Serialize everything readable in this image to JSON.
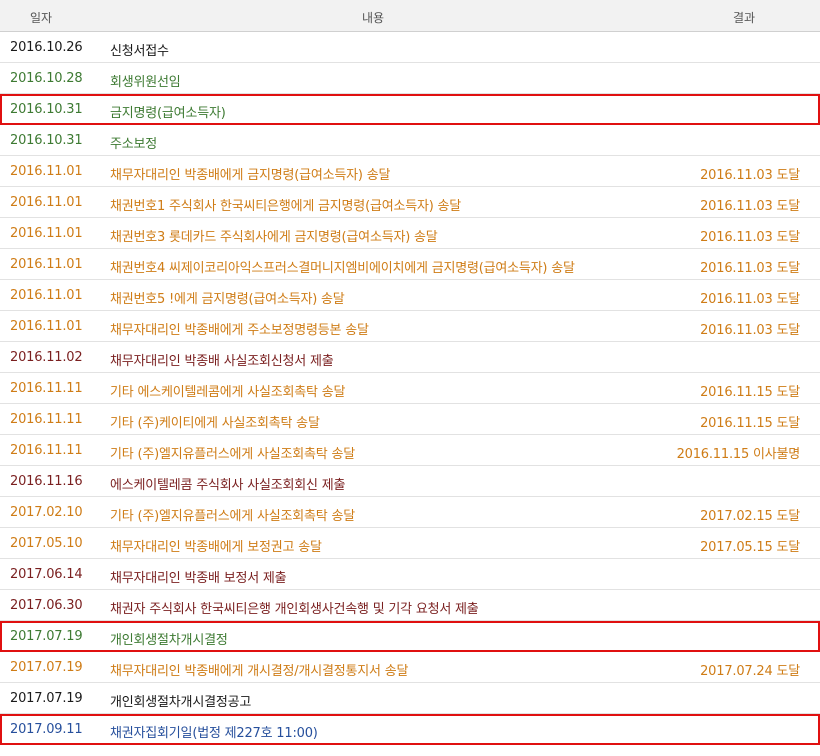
{
  "columns": {
    "date": "일자",
    "content": "내용",
    "result": "결과"
  },
  "rows": [
    {
      "date": "2016.10.26",
      "content": "신청서접수",
      "result": "",
      "color": "#1a1a1a"
    },
    {
      "date": "2016.10.28",
      "content": "회생위원선임",
      "result": "",
      "color": "#3d7a32"
    },
    {
      "date": "2016.10.31",
      "content": "금지명령(급여소득자)",
      "result": "",
      "color": "#3d7a32",
      "highlighted": true
    },
    {
      "date": "2016.10.31",
      "content": "주소보정",
      "result": "",
      "color": "#3d7a32"
    },
    {
      "date": "2016.11.01",
      "content": "채무자대리인 박종배에게 금지명령(급여소득자) 송달",
      "result": "2016.11.03 도달",
      "color": "#cf7c16"
    },
    {
      "date": "2016.11.01",
      "content": "채권번호1 주식회사 한국씨티은행에게 금지명령(급여소득자) 송달",
      "result": "2016.11.03 도달",
      "color": "#cf7c16"
    },
    {
      "date": "2016.11.01",
      "content": "채권번호3 롯데카드 주식회사에게 금지명령(급여소득자) 송달",
      "result": "2016.11.03 도달",
      "color": "#cf7c16"
    },
    {
      "date": "2016.11.01",
      "content": "채권번호4 씨제이코리아익스프러스결머니지엠비에이치에게 금지명령(급여소득자) 송달",
      "result": "2016.11.03 도달",
      "color": "#cf7c16"
    },
    {
      "date": "2016.11.01",
      "content": "채권번호5        !에게 금지명령(급여소득자) 송달",
      "result": "2016.11.03 도달",
      "color": "#cf7c16"
    },
    {
      "date": "2016.11.01",
      "content": "채무자대리인 박종배에게 주소보정명령등본 송달",
      "result": "2016.11.03 도달",
      "color": "#cf7c16"
    },
    {
      "date": "2016.11.02",
      "content": "채무자대리인 박종배 사실조회신청서 제출",
      "result": "",
      "color": "#7a1f1f"
    },
    {
      "date": "2016.11.11",
      "content": "기타 에스케이텔레콤에게 사실조회촉탁 송달",
      "result": "2016.11.15 도달",
      "color": "#cf7c16"
    },
    {
      "date": "2016.11.11",
      "content": "기타 (주)케이티에게 사실조회촉탁 송달",
      "result": "2016.11.15 도달",
      "color": "#cf7c16"
    },
    {
      "date": "2016.11.11",
      "content": "기타 (주)엘지유플러스에게 사실조회촉탁 송달",
      "result": "2016.11.15 이사불명",
      "color": "#cf7c16"
    },
    {
      "date": "2016.11.16",
      "content": "에스케이텔레콤 주식회사 사실조회회신 제출",
      "result": "",
      "color": "#7a1f1f"
    },
    {
      "date": "2017.02.10",
      "content": "기타 (주)엘지유플러스에게 사실조회촉탁 송달",
      "result": "2017.02.15 도달",
      "color": "#cf7c16"
    },
    {
      "date": "2017.05.10",
      "content": "채무자대리인 박종배에게 보정권고 송달",
      "result": "2017.05.15 도달",
      "color": "#cf7c16"
    },
    {
      "date": "2017.06.14",
      "content": "채무자대리인 박종배 보정서 제출",
      "result": "",
      "color": "#7a1f1f"
    },
    {
      "date": "2017.06.30",
      "content": "채권자 주식회사 한국씨티은행 개인회생사건속행 및 기각 요청서 제출",
      "result": "",
      "color": "#7a1f1f"
    },
    {
      "date": "2017.07.19",
      "content": "개인회생절차개시결정",
      "result": "",
      "color": "#3d7a32",
      "highlighted": true
    },
    {
      "date": "2017.07.19",
      "content": "채무자대리인 박종배에게 개시결정/개시결정통지서 송달",
      "result": "2017.07.24 도달",
      "color": "#cf7c16"
    },
    {
      "date": "2017.07.19",
      "content": "개인회생절차개시결정공고",
      "result": "",
      "color": "#1a1a1a"
    },
    {
      "date": "2017.09.11",
      "content": "채권자집회기일(법정 제227호 11:00)",
      "result": "",
      "color": "#264f9c",
      "highlighted": true
    }
  ]
}
